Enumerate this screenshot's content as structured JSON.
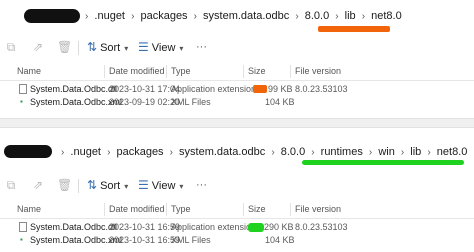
{
  "colors": {
    "orange_highlight": "#f2640a",
    "green_highlight": "#1fd21f",
    "accent": "#3a6fb0"
  },
  "toolbar": {
    "sort_label": "Sort",
    "view_label": "View"
  },
  "columns": {
    "name": "Name",
    "date_modified": "Date modified",
    "type": "Type",
    "size": "Size",
    "file_version": "File version"
  },
  "top_window": {
    "breadcrumbs": [
      ".nuget",
      "packages",
      "system.data.odbc",
      "8.0.0",
      "lib",
      "net8.0"
    ],
    "files": [
      {
        "name": "System.Data.Odbc.dll",
        "date": "2023-10-31 17:04",
        "type": "Application extension",
        "size": "99 KB",
        "version": "8.0.23.53103",
        "icon": "dll-file-icon"
      },
      {
        "name": "System.Data.Odbc.xml",
        "date": "2023-09-19 02:20",
        "type": "XML Files",
        "size": "104 KB",
        "version": "",
        "icon": "xml-file-icon"
      }
    ]
  },
  "bottom_window": {
    "breadcrumbs": [
      ".nuget",
      "packages",
      "system.data.odbc",
      "8.0.0",
      "runtimes",
      "win",
      "lib",
      "net8.0"
    ],
    "files": [
      {
        "name": "System.Data.Odbc.dll",
        "date": "2023-10-31 16:59",
        "type": "Application extension",
        "size": "290 KB",
        "version": "8.0.23.53103",
        "icon": "dll-file-icon"
      },
      {
        "name": "System.Data.Odbc.xml",
        "date": "2023-10-31 16:59",
        "type": "XML Files",
        "size": "104 KB",
        "version": "",
        "icon": "xml-file-icon"
      }
    ]
  }
}
